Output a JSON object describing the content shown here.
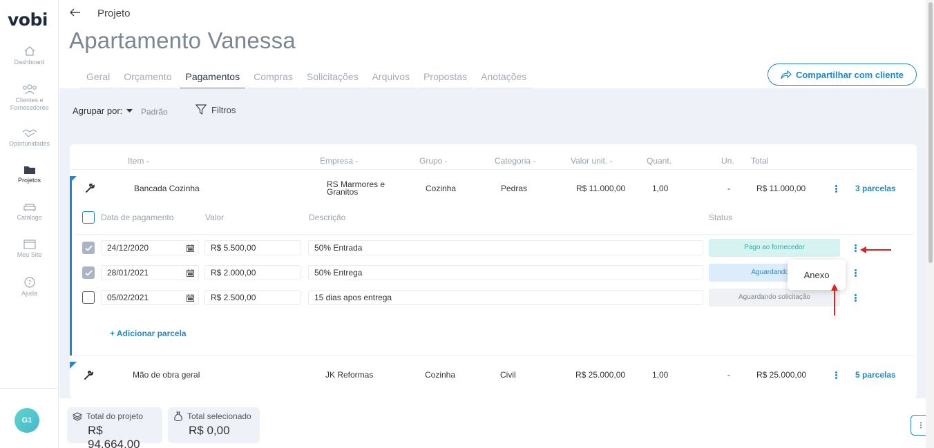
{
  "app": {
    "logo": "vobi"
  },
  "sidebar": {
    "items": [
      {
        "label": "Dashboard",
        "icon": "home-icon"
      },
      {
        "label": "Clientes e Fornecedores",
        "icon": "users-icon"
      },
      {
        "label": "Oportunidades",
        "icon": "handshake-icon"
      },
      {
        "label": "Projetos",
        "icon": "folder-icon"
      },
      {
        "label": "Catálogo",
        "icon": "sofa-icon"
      },
      {
        "label": "Meu Site",
        "icon": "browser-icon"
      },
      {
        "label": "Ajuda",
        "icon": "help-icon"
      }
    ],
    "avatar": "G1"
  },
  "header": {
    "breadcrumb": "Projeto",
    "title": "Apartamento Vanessa",
    "share_label": "Compartilhar com cliente"
  },
  "tabs": [
    "Geral",
    "Orçamento",
    "Pagamentos",
    "Compras",
    "Solicitações",
    "Arquivos",
    "Propostas",
    "Anotações"
  ],
  "active_tab": "Pagamentos",
  "toolbar": {
    "group_by_label": "Agrupar por:",
    "group_by_value": "Padrão",
    "filter_label": "Filtros"
  },
  "table": {
    "headers": {
      "item": "Item -",
      "empresa": "Empresa -",
      "grupo": "Grupo -",
      "categoria": "Categoria -",
      "valor_unit": "Valor unit. -",
      "quant": "Quant.",
      "un": "Un.",
      "total": "Total"
    },
    "rows": [
      {
        "item": "Bancada Cozinha",
        "empresa": "RS Marmores e Granitos",
        "grupo": "Cozinha",
        "categoria": "Pedras",
        "valor_unit": "R$ 11.000,00",
        "quant": "1,00",
        "un": "-",
        "total": "R$ 11.000,00",
        "parcelas": "3 parcelas"
      },
      {
        "item": "Mão de obra geral",
        "empresa": "JK Reformas",
        "grupo": "Cozinha",
        "categoria": "Civil",
        "valor_unit": "R$ 25.000,00",
        "quant": "1,00",
        "un": "-",
        "total": "R$ 25.000,00",
        "parcelas": "5 parcelas"
      }
    ]
  },
  "installments": {
    "headers": {
      "date": "Data de pagamento",
      "value": "Valor",
      "description": "Descrição",
      "status": "Status"
    },
    "rows": [
      {
        "date": "24/12/2020",
        "value": "R$ 5.500,00",
        "description": "50% Entrada",
        "status": "Pago ao fornecedor",
        "checked": true
      },
      {
        "date": "28/01/2021",
        "value": "R$ 2.000,00",
        "description": "50% Entrega",
        "status": "Aguardando lib",
        "checked": true
      },
      {
        "date": "05/02/2021",
        "value": "R$ 2.500,00",
        "description": "15 dias apos entrega",
        "status": "Aguardando solicitação",
        "checked": false
      }
    ],
    "add_label": "+ Adicionar parcela"
  },
  "popup": {
    "label": "Anexo"
  },
  "footer": {
    "total_project_label": "Total do projeto",
    "total_project_value": "R$ 94.664,00",
    "total_selected_label": "Total selecionado",
    "total_selected_value": "R$ 0,00"
  },
  "colors": {
    "accent": "#1e88c8",
    "annotation_arrow": "#e02020"
  }
}
